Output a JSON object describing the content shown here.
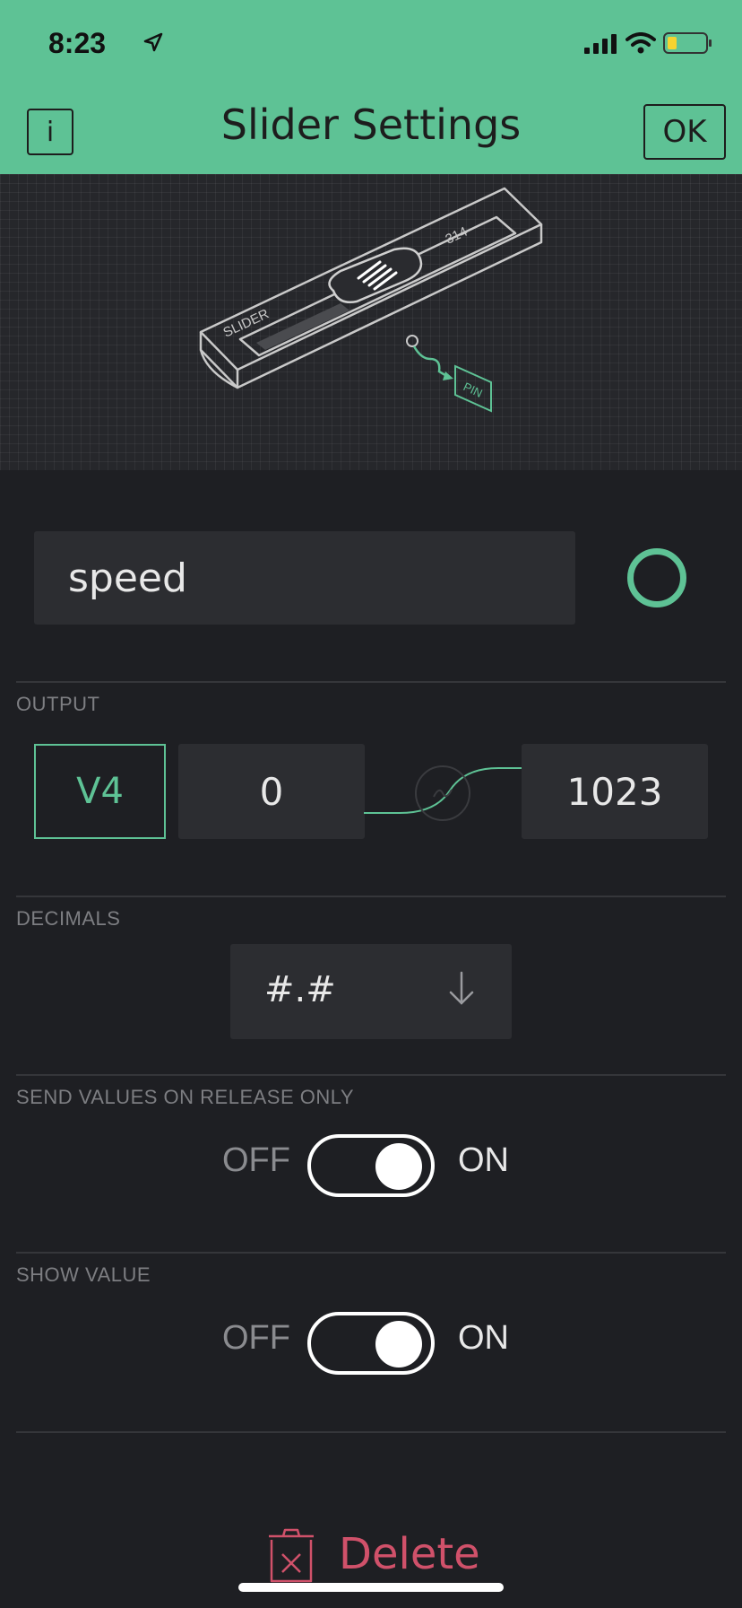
{
  "status_bar": {
    "time": "8:23"
  },
  "header": {
    "info_label": "i",
    "title": "Slider Settings",
    "ok_label": "OK"
  },
  "illustration": {
    "slider_label": "SLIDER",
    "value_label": "314",
    "pin_label": "PIN"
  },
  "name_field": {
    "value": "speed"
  },
  "accent_color": "#5ec295",
  "output": {
    "section_label": "OUTPUT",
    "pin": "V4",
    "min": "0",
    "max": "1023"
  },
  "decimals": {
    "section_label": "DECIMALS",
    "value": "#.#"
  },
  "send_on_release": {
    "section_label": "SEND VALUES ON RELEASE ONLY",
    "off_label": "OFF",
    "on_label": "ON",
    "state": "on"
  },
  "show_value": {
    "section_label": "SHOW VALUE",
    "off_label": "OFF",
    "on_label": "ON",
    "state": "on"
  },
  "delete": {
    "label": "Delete"
  },
  "icons": [
    "location-arrow-icon",
    "signal-icon",
    "wifi-icon",
    "battery-icon",
    "chevron-down-icon",
    "trash-icon"
  ]
}
